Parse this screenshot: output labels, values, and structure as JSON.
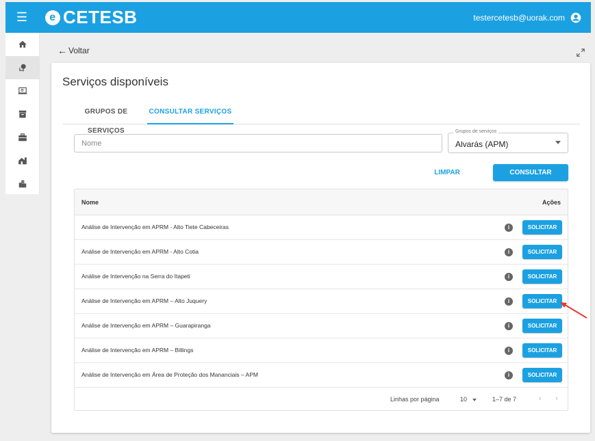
{
  "header": {
    "menu_icon": "hamburger-icon",
    "logo_text": "CETESB",
    "logo_mark": "e",
    "user_email": "testercetesb@uorak.com",
    "user_icon": "account-circle-icon",
    "bar_color": "#1ba1e2"
  },
  "sidebar": {
    "items": [
      {
        "icon": "home-icon"
      },
      {
        "icon": "tree-icon",
        "active": true
      },
      {
        "icon": "laptop-icon"
      },
      {
        "icon": "archive-icon"
      },
      {
        "icon": "briefcase-icon"
      },
      {
        "icon": "house-icon"
      },
      {
        "icon": "buildings-icon"
      }
    ]
  },
  "nav": {
    "back_arrow": "←",
    "back_label": "Voltar",
    "expand_icon": "expand-icon"
  },
  "page": {
    "title": "Serviços disponíveis",
    "tabs": [
      {
        "label": "GRUPOS DE SERVIÇOS",
        "active": false
      },
      {
        "label": "CONSULTAR SERVIÇOS",
        "active": true
      }
    ]
  },
  "filters": {
    "name_placeholder": "Nome",
    "name_value": "",
    "group_label": "Grupos de serviços",
    "group_value": "Alvarás (APM)",
    "clear_label": "LIMPAR",
    "search_label": "CONSULTAR"
  },
  "table": {
    "header_name": "Nome",
    "header_actions": "Ações",
    "info_glyph": "i",
    "action_label": "SOLICITAR",
    "rows": [
      {
        "name": "Análise de Intervenção em APRM - Alto Tiete Cabeceiras"
      },
      {
        "name": "Análise de Intervenção em APRM - Alto Cotia"
      },
      {
        "name": "Análise de Intervenção na Serra do Itapeti"
      },
      {
        "name": "Análise de Intervenção em APRM – Alto Juquery"
      },
      {
        "name": "Análise de Intervenção em APRM – Guarapiranga"
      },
      {
        "name": "Análise de Intervenção em APRM – Billings"
      },
      {
        "name": "Análise de Intervenção em Área de Proteção dos Mananciais – APM"
      }
    ],
    "pagination": {
      "rows_per_page_label": "Linhas por página",
      "rows_per_page_value": "10",
      "range_label": "1–7 de 7",
      "prev_glyph": "‹",
      "next_glyph": "›"
    }
  },
  "annotation": {
    "arrow_color": "#e53935",
    "points_to": "Análise de Intervenção em APRM – Alto Juquery"
  }
}
